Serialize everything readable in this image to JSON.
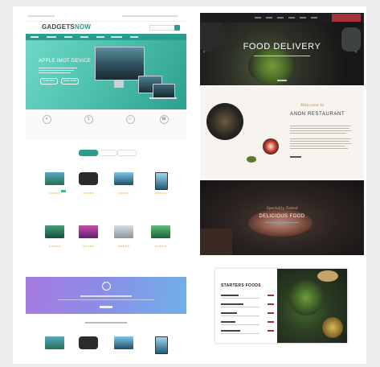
{
  "gadgets": {
    "logo_main": "GADGETS",
    "logo_accent": "NOW",
    "hero_title": "APPLE IMOT DEVICE",
    "hero_buttons": [
      "SHOP NOW",
      "LEARN MORE"
    ]
  },
  "food": {
    "hero_title": "FOOD DELIVERY",
    "about_script": "Welcome to",
    "about_title": "ANON RESTAURANT",
    "special_script": "Speciality Tasted",
    "special_title": "DELICIOUS FOOD"
  },
  "starters": {
    "title": "STARTERS FOODS"
  },
  "colors": {
    "gadgets_accent": "#2a9d8f",
    "food_accent": "#a8323a",
    "rating_star": "#f0a500"
  }
}
